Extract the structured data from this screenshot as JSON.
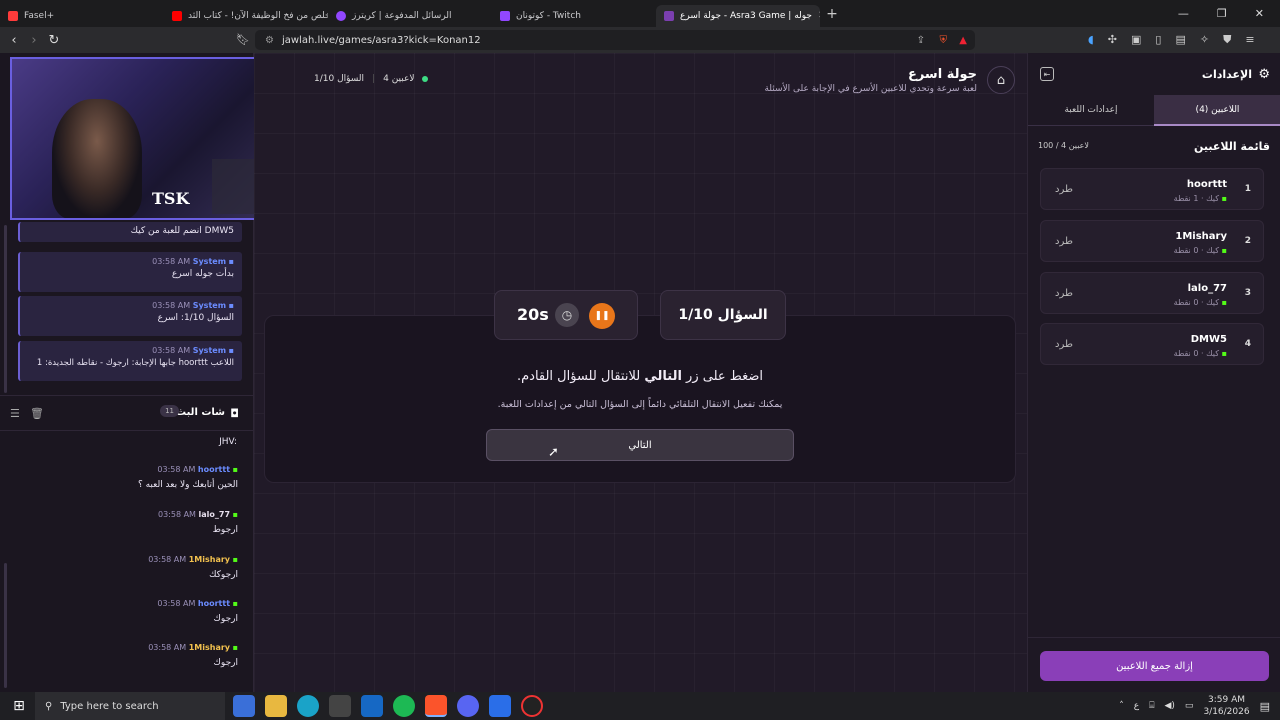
{
  "browser": {
    "tabs": [
      {
        "label": "Fasel+",
        "color": "#ff3b3b"
      },
      {
        "label": "تخلص من فخ الوظيفة الآن! - كتاب الثد...",
        "color": "#ff0000"
      },
      {
        "label": "الرسائل المدفوعة | كريترز",
        "color": "#9147ff"
      },
      {
        "label": "كوتونان - Twitch",
        "color": "#9147ff"
      },
      {
        "label": "جولة اسرع - Asra3 Game | جوله",
        "color": "#7b3fb0"
      }
    ],
    "url": "jawlah.live/games/asra3?kick=Konan12"
  },
  "left": {
    "system_messages": [
      {
        "user": "",
        "time": "",
        "text": "DMW5 انضم للعبة من كيك"
      },
      {
        "user": "System",
        "time": "03:58 AM",
        "text": "بدأت جوله اسرع"
      },
      {
        "user": "System",
        "time": "03:58 AM",
        "text": "السؤال 1/10: اسرع"
      },
      {
        "user": "System",
        "time": "03:58 AM",
        "text": "اللاعب hoorttt جابها الإجابة: ارجوك - نقاطه الجديدة: 1"
      }
    ],
    "chat_title": "شات البث",
    "chat_count": "11",
    "chat_partial": "JHV:",
    "chat_messages": [
      {
        "user": "hoorttt",
        "time": "03:58 AM",
        "text": "الحين أتابعك ولا بعد العبه ؟",
        "color": "#6b8cff"
      },
      {
        "user": "lalo_77",
        "time": "03:58 AM",
        "text": "ارجوط",
        "color": "#e8e0ee"
      },
      {
        "user": "1Mishary",
        "time": "03:58 AM",
        "text": "ارجوكك",
        "color": "#f2c14e"
      },
      {
        "user": "hoorttt",
        "time": "03:58 AM",
        "text": "ارجوك",
        "color": "#6b8cff"
      },
      {
        "user": "1Mishary",
        "time": "03:58 AM",
        "text": "ارجوك",
        "color": "#f2c14e"
      }
    ]
  },
  "main": {
    "title": "جولة اسرع",
    "subtitle": "لعبة سرعة وتحدي للاعبين الأسرع في الإجابة على الأسئلة",
    "players_status": "4 لاعبين",
    "question_status": "السؤال 1/10",
    "question_label": "السؤال 1/10",
    "timer": "20s",
    "prompt_prefix": "اضغط على زر",
    "prompt_bold": "التالي",
    "prompt_suffix": "للانتقال للسؤال القادم.",
    "hint": "يمكنك تفعيل الانتقال التلقائي دائماً إلى السؤال التالي من إعدادات اللعبة.",
    "next_button": "التالي"
  },
  "right": {
    "title": "الإعدادات",
    "tab_players": "اللاعبين (4)",
    "tab_game": "إعدادات اللعبة",
    "list_title": "قائمة اللاعبين",
    "list_count": "100 / 4 لاعبين",
    "players": [
      {
        "rank": "1",
        "name": "hoorttt",
        "platform": "كيك",
        "points": "1 نقطة",
        "kick": "طرد"
      },
      {
        "rank": "2",
        "name": "1Mishary",
        "platform": "كيك",
        "points": "0 نقطة",
        "kick": "طرد"
      },
      {
        "rank": "3",
        "name": "lalo_77",
        "platform": "كيك",
        "points": "0 نقطة",
        "kick": "طرد"
      },
      {
        "rank": "4",
        "name": "DMW5",
        "platform": "كيك",
        "points": "0 نقطة",
        "kick": "طرد"
      }
    ],
    "remove_all": "إزالة جميع اللاعبين"
  },
  "taskbar": {
    "search_placeholder": "Type here to search",
    "lang": "ع",
    "time": "3:59 AM",
    "date": "3/16/2026"
  },
  "colors": {
    "accent_purple": "#8a3fb8",
    "pause_orange": "#e8761a",
    "kick_green": "#53fc18"
  }
}
